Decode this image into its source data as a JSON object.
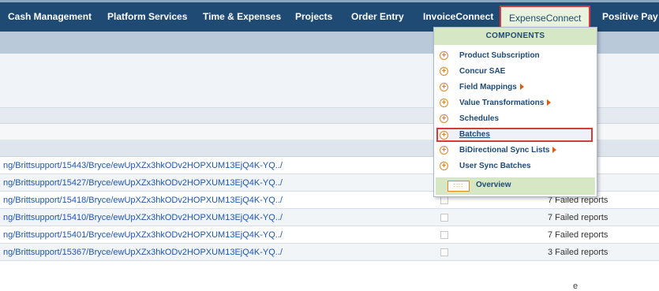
{
  "nav": {
    "items": [
      {
        "label": "Cash Management",
        "active": false
      },
      {
        "label": "Platform Services",
        "active": false
      },
      {
        "label": "Time & Expenses",
        "active": false
      },
      {
        "label": "Projects",
        "active": false
      },
      {
        "label": "Order Entry",
        "active": false
      },
      {
        "label": "InvoiceConnect",
        "active": false
      },
      {
        "label": "ExpenseConnect",
        "active": true
      },
      {
        "label": "Positive Pay",
        "active": false
      }
    ]
  },
  "components_menu": {
    "header": "COMPONENTS",
    "items": [
      {
        "label": "Product Subscription",
        "has_submenu": false
      },
      {
        "label": "Concur SAE",
        "has_submenu": false
      },
      {
        "label": "Field Mappings",
        "has_submenu": true
      },
      {
        "label": "Value Transformations",
        "has_submenu": true
      },
      {
        "label": "Schedules",
        "has_submenu": false
      },
      {
        "label": "Batches",
        "has_submenu": false,
        "highlighted": true
      },
      {
        "label": "BiDirectional Sync Lists",
        "has_submenu": true
      },
      {
        "label": "User Sync Batches",
        "has_submenu": false
      }
    ],
    "footer_label": "Overview"
  },
  "table": {
    "header_status_fragment": "e",
    "rows": [
      {
        "link": "ng/Brittsupport/15443/Bryce/ewUpXZx3hkODv2HOPXUM13EjQ4K-YQ../",
        "status": "reports"
      },
      {
        "link": "ng/Brittsupport/15427/Bryce/ewUpXZx3hkODv2HOPXUM13EjQ4K-YQ../",
        "status": "ts"
      },
      {
        "link": "ng/Brittsupport/15418/Bryce/ewUpXZx3hkODv2HOPXUM13EjQ4K-YQ../",
        "status": "7 Failed reports"
      },
      {
        "link": "ng/Brittsupport/15410/Bryce/ewUpXZx3hkODv2HOPXUM13EjQ4K-YQ../",
        "status": "7 Failed reports"
      },
      {
        "link": "ng/Brittsupport/15401/Bryce/ewUpXZx3hkODv2HOPXUM13EjQ4K-YQ../",
        "status": "7 Failed reports"
      },
      {
        "link": "ng/Brittsupport/15367/Bryce/ewUpXZx3hkODv2HOPXUM13EjQ4K-YQ../",
        "status": "3 Failed reports"
      }
    ]
  },
  "colors": {
    "nav_bg": "#1f4a73",
    "menu_header_bg": "#d6e7c5",
    "highlight_border": "#d63a3a",
    "icon_orange": "#e08a1e",
    "link": "#1f56a8"
  }
}
